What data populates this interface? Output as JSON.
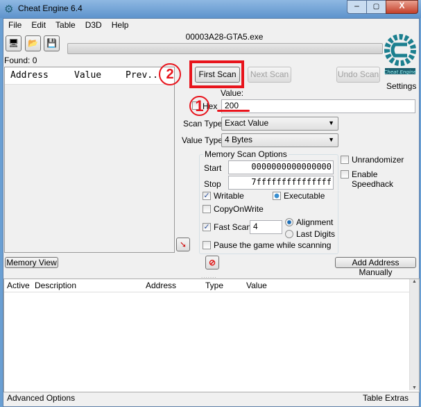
{
  "window": {
    "title": "Cheat Engine 6.4",
    "process": "00003A28-GTA5.exe",
    "found": "Found: 0"
  },
  "menu": [
    "File",
    "Edit",
    "Table",
    "D3D",
    "Help"
  ],
  "results_list": {
    "columns": [
      "Address",
      "Value",
      "Prev.."
    ]
  },
  "buttons": {
    "first_scan": "First Scan",
    "next_scan": "Next Scan",
    "undo_scan": "Undo Scan",
    "settings": "Settings",
    "memory_view": "Memory View",
    "add_address": "Add Address Manually"
  },
  "scan": {
    "value_label": "Value:",
    "hex_label": "Hex",
    "value": "200",
    "scan_type_label": "Scan Type",
    "scan_type": "Exact Value",
    "value_type_label": "Value Type",
    "value_type": "4 Bytes"
  },
  "memory_options": {
    "title": "Memory Scan Options",
    "start_label": "Start",
    "start": "0000000000000000",
    "stop_label": "Stop",
    "stop": "7fffffffffffffff",
    "writable": "Writable",
    "executable": "Executable",
    "copy_on_write": "CopyOnWrite",
    "fast_scan": "Fast Scan",
    "fast_scan_value": "4",
    "alignment": "Alignment",
    "last_digits": "Last Digits",
    "pause": "Pause the game while scanning"
  },
  "extras": {
    "unrandomizer": "Unrandomizer",
    "speedhack": "Enable Speedhack"
  },
  "address_table": {
    "columns": [
      "Active",
      "Description",
      "Address",
      "Type",
      "Value"
    ]
  },
  "status": {
    "left": "Advanced Options",
    "right": "Table Extras"
  },
  "annotations": {
    "step1": "1",
    "step2": "2",
    "color": "#e8141c"
  },
  "logo_text": "Cheat Engine"
}
